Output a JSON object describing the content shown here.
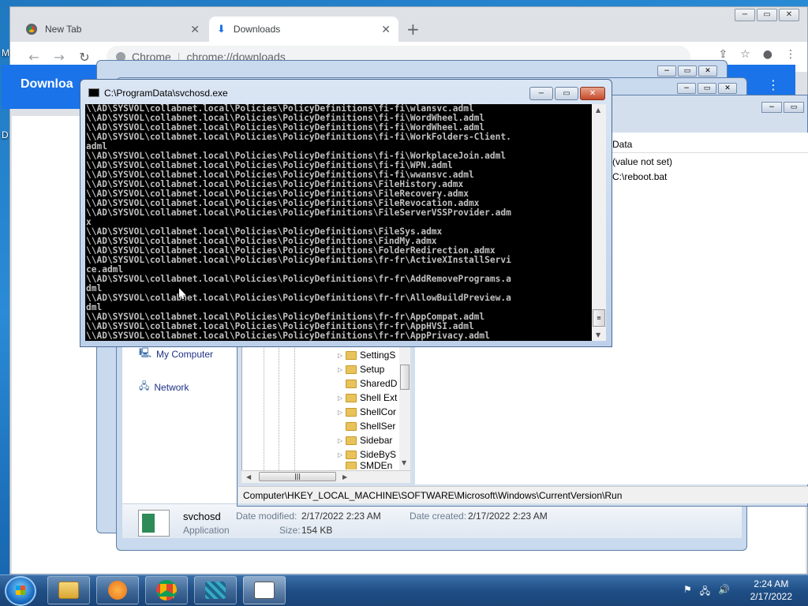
{
  "desktop": {
    "icon_labels": [
      "M",
      "D"
    ]
  },
  "chrome": {
    "tabs": [
      {
        "title": "New Tab",
        "active": false,
        "icon": "chrome-icon"
      },
      {
        "title": "Downloads",
        "active": true,
        "icon": "download-icon"
      }
    ],
    "tab_close": "✕",
    "new_tab": "+",
    "window_controls": [
      "−",
      "▭",
      "✕"
    ],
    "omnibox": {
      "site": "Chrome",
      "url": "chrome://downloads"
    },
    "page_header": "Downloa",
    "more_menu": "⋮"
  },
  "console": {
    "title": "C:\\ProgramData\\svchosd.exe",
    "controls": [
      "−",
      "▭",
      "✕"
    ],
    "lines": [
      "\\\\AD\\SYSVOL\\collabnet.local\\Policies\\PolicyDefinitions\\fi-fi\\wlansvc.adml",
      "\\\\AD\\SYSVOL\\collabnet.local\\Policies\\PolicyDefinitions\\fi-fi\\WordWheel.adml",
      "\\\\AD\\SYSVOL\\collabnet.local\\Policies\\PolicyDefinitions\\fi-fi\\WordWheel.adml",
      "\\\\AD\\SYSVOL\\collabnet.local\\Policies\\PolicyDefinitions\\fi-fi\\WorkFolders-Client.",
      "adml",
      "\\\\AD\\SYSVOL\\collabnet.local\\Policies\\PolicyDefinitions\\fi-fi\\WorkplaceJoin.adml",
      "\\\\AD\\SYSVOL\\collabnet.local\\Policies\\PolicyDefinitions\\fi-fi\\WPN.adml",
      "\\\\AD\\SYSVOL\\collabnet.local\\Policies\\PolicyDefinitions\\fi-fi\\wwansvc.adml",
      "\\\\AD\\SYSVOL\\collabnet.local\\Policies\\PolicyDefinitions\\FileHistory.admx",
      "\\\\AD\\SYSVOL\\collabnet.local\\Policies\\PolicyDefinitions\\FileRecovery.admx",
      "\\\\AD\\SYSVOL\\collabnet.local\\Policies\\PolicyDefinitions\\FileRevocation.admx",
      "\\\\AD\\SYSVOL\\collabnet.local\\Policies\\PolicyDefinitions\\FileServerVSSProvider.adm",
      "x",
      "\\\\AD\\SYSVOL\\collabnet.local\\Policies\\PolicyDefinitions\\FileSys.admx",
      "\\\\AD\\SYSVOL\\collabnet.local\\Policies\\PolicyDefinitions\\FindMy.admx",
      "\\\\AD\\SYSVOL\\collabnet.local\\Policies\\PolicyDefinitions\\FolderRedirection.admx",
      "\\\\AD\\SYSVOL\\collabnet.local\\Policies\\PolicyDefinitions\\fr-fr\\ActiveXInstallServi",
      "ce.adml",
      "\\\\AD\\SYSVOL\\collabnet.local\\Policies\\PolicyDefinitions\\fr-fr\\AddRemovePrograms.a",
      "dml",
      "\\\\AD\\SYSVOL\\collabnet.local\\Policies\\PolicyDefinitions\\fr-fr\\AllowBuildPreview.a",
      "dml",
      "\\\\AD\\SYSVOL\\collabnet.local\\Policies\\PolicyDefinitions\\fr-fr\\AppCompat.adml",
      "\\\\AD\\SYSVOL\\collabnet.local\\Policies\\PolicyDefinitions\\fr-fr\\AppHVSI.adml",
      "\\\\AD\\SYSVOL\\collabnet.local\\Policies\\PolicyDefinitions\\fr-fr\\AppPrivacy.adml"
    ]
  },
  "regedit": {
    "column_header": "Data",
    "values": [
      "(value not set)",
      "C:\\reboot.bat"
    ],
    "tree_items": [
      "SettingS",
      "Setup",
      "SharedD",
      "Shell Ext",
      "ShellCor",
      "ShellSer",
      "Sidebar",
      "SideByS",
      "SMDEn"
    ],
    "status_path": "Computer\\HKEY_LOCAL_MACHINE\\SOFTWARE\\Microsoft\\Windows\\CurrentVersion\\Run"
  },
  "explorer": {
    "nav_items": [
      "My Computer",
      "Network"
    ],
    "file": {
      "name": "svchosd",
      "type": "Application",
      "modified_label": "Date modified:",
      "modified": "2/17/2022 2:23 AM",
      "created_label": "Date created:",
      "created": "2/17/2022 2:23 AM",
      "size_label": "Size:",
      "size": "154 KB"
    }
  },
  "taskbar": {
    "time": "2:24 AM",
    "date": "2/17/2022",
    "pinned": [
      "explorer-icon",
      "media-player-icon",
      "chrome-icon",
      "network-app-icon",
      "console-app-icon"
    ]
  }
}
